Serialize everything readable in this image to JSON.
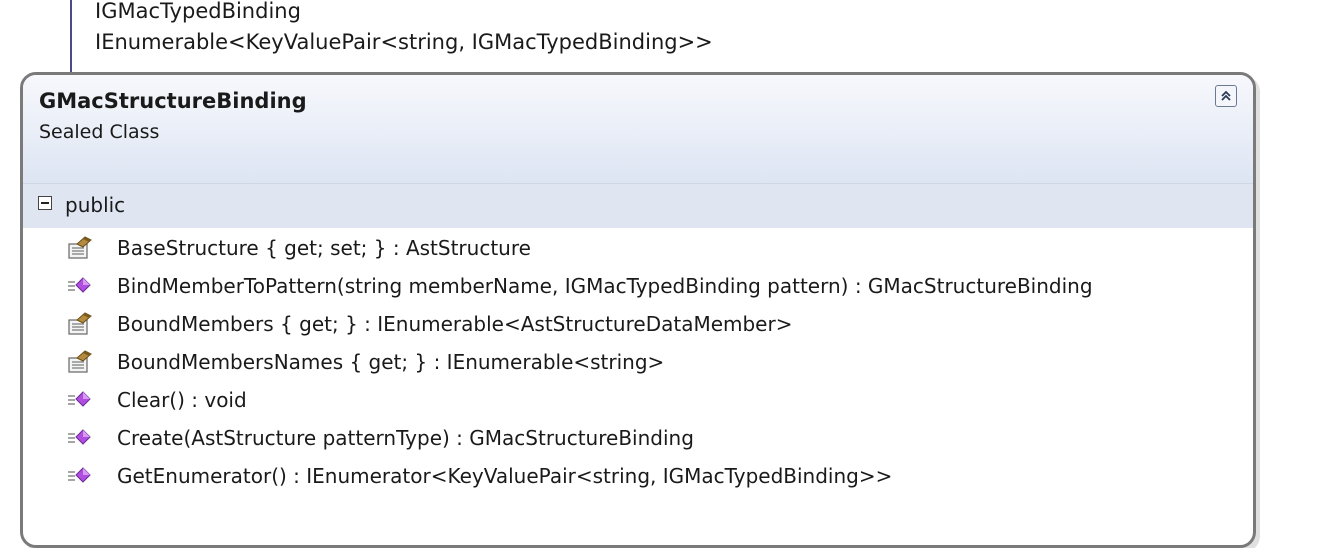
{
  "above_lines": [
    "IGMacTypedBinding",
    "IEnumerable<KeyValuePair<string, IGMacTypedBinding>>"
  ],
  "class": {
    "name": "GMacStructureBinding",
    "kind": "Sealed Class"
  },
  "section": {
    "label": "public"
  },
  "members": [
    {
      "icon": "property-icon",
      "text": "BaseStructure { get; set; } : AstStructure"
    },
    {
      "icon": "method-icon",
      "text": "BindMemberToPattern(string memberName, IGMacTypedBinding pattern) : GMacStructureBinding"
    },
    {
      "icon": "property-icon",
      "text": "BoundMembers { get; } : IEnumerable<AstStructureDataMember>"
    },
    {
      "icon": "property-icon",
      "text": "BoundMembersNames { get; } : IEnumerable<string>"
    },
    {
      "icon": "method-icon",
      "text": "Clear() : void"
    },
    {
      "icon": "method-icon",
      "text": "Create(AstStructure patternType) : GMacStructureBinding"
    },
    {
      "icon": "method-icon",
      "text": "GetEnumerator() : IEnumerator<KeyValuePair<string, IGMacTypedBinding>>"
    }
  ],
  "colors": {
    "header_gradient_top": "#f7f8fc",
    "header_gradient_bottom": "#dde5f3",
    "section_bg": "#dfe6f2",
    "border": "#7a7a7a",
    "method_icon": "#9b3fc6"
  }
}
